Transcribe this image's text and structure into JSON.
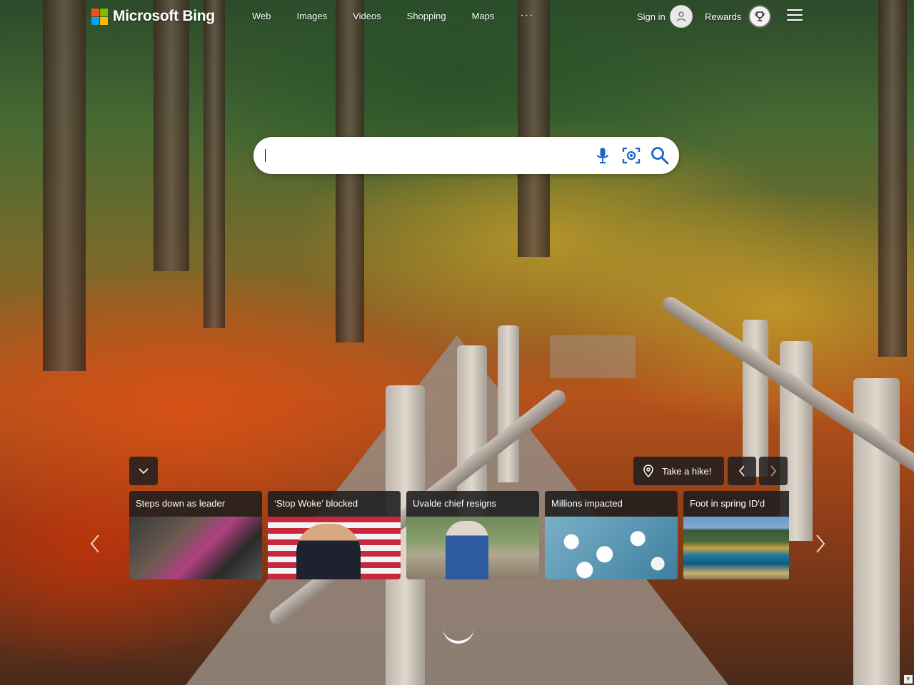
{
  "header": {
    "brand": "Microsoft Bing",
    "logo_colors": [
      "#f25022",
      "#7fba00",
      "#00a4ef",
      "#ffb900"
    ],
    "nav": [
      {
        "label": "Web"
      },
      {
        "label": "Images"
      },
      {
        "label": "Videos"
      },
      {
        "label": "Shopping"
      },
      {
        "label": "Maps"
      }
    ],
    "more_label": "···",
    "signin_label": "Sign in",
    "rewards_label": "Rewards"
  },
  "search": {
    "value": "",
    "placeholder": "",
    "icons": [
      "microphone-icon",
      "visual-search-icon",
      "search-icon"
    ]
  },
  "controls": {
    "hike_label": "Take a hike!"
  },
  "news": [
    {
      "title": "Steps down as leader"
    },
    {
      "title": "‘Stop Woke’ blocked"
    },
    {
      "title": "Uvalde chief resigns"
    },
    {
      "title": "Millions impacted"
    },
    {
      "title": "Foot in spring ID'd"
    }
  ]
}
